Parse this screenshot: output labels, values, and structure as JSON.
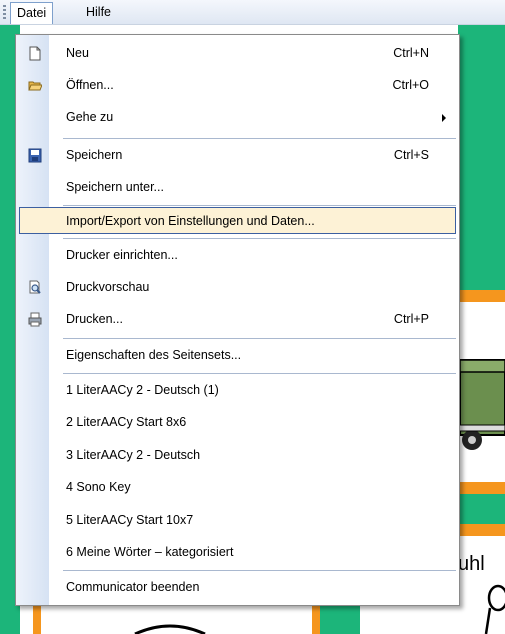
{
  "menubar": {
    "datei": "Datei",
    "hilfe": "Hilfe"
  },
  "menu": {
    "neu": {
      "label": "Neu",
      "shortcut": "Ctrl+N"
    },
    "oeffnen": {
      "label": "Öffnen...",
      "shortcut": "Ctrl+O"
    },
    "gehe_zu": {
      "label": "Gehe zu"
    },
    "speichern": {
      "label": "Speichern",
      "shortcut": "Ctrl+S"
    },
    "speichern_unter": {
      "label": "Speichern unter..."
    },
    "import_export": {
      "label": "Import/Export von Einstellungen und Daten..."
    },
    "drucker_einrichten": {
      "label": "Drucker einrichten..."
    },
    "druckvorschau": {
      "label": "Druckvorschau"
    },
    "drucken": {
      "label": "Drucken...",
      "shortcut": "Ctrl+P"
    },
    "eigenschaften": {
      "label": "Eigenschaften des Seitensets..."
    },
    "recent": [
      "1 LiterAACy 2 - Deutsch (1)",
      "2 LiterAACy Start 8x6",
      "3 LiterAACy 2 - Deutsch",
      "4 Sono Key",
      "5 LiterAACy Start 10x7",
      "6 Meine Wörter – kategorisiert"
    ],
    "beenden": {
      "label": "Communicator beenden"
    }
  },
  "background": {
    "cell_text": "uhl"
  },
  "colors": {
    "highlight_bg": "#fdf2d6",
    "highlight_border": "#3c5fa0",
    "app_green": "#1cb57a",
    "app_orange": "#f5961e"
  }
}
